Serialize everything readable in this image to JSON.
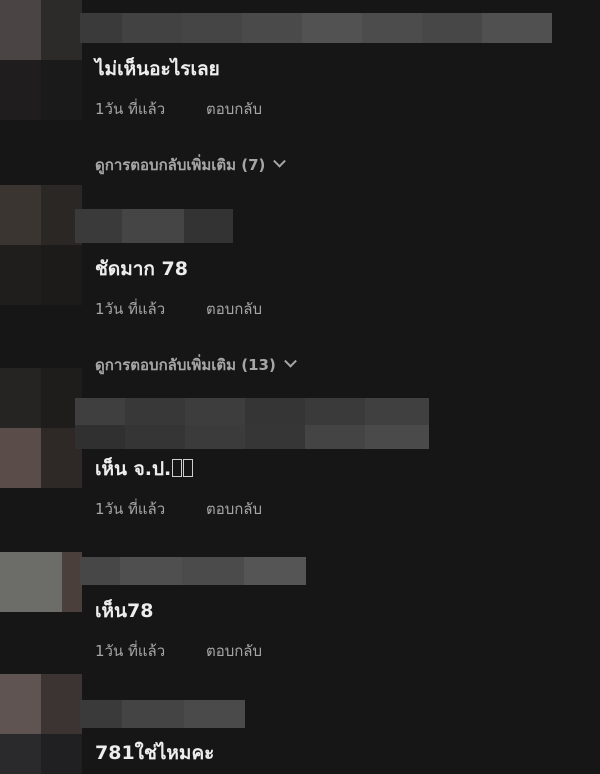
{
  "comments": [
    {
      "text": "ไม่เห็นอะไรเลย",
      "time": "1วัน ที่แล้ว",
      "reply": "ตอบกลับ",
      "more_replies": "ดูการตอบกลับเพิ่มเติม (7)"
    },
    {
      "text": "ชัดมาก 78",
      "time": "1วัน ที่แล้ว",
      "reply": "ตอบกลับ",
      "more_replies": "ดูการตอบกลับเพิ่มเติม (13)"
    },
    {
      "text": "เห็น จ.ป.",
      "time": "1วัน ที่แล้ว",
      "reply": "ตอบกลับ"
    },
    {
      "text": "เห็น78",
      "time": "1วัน ที่แล้ว",
      "reply": "ตอบกลับ"
    },
    {
      "text": "781ใช่ไหมคะ"
    }
  ],
  "icons": {
    "expand": "chevron-down-icon"
  },
  "colors": {
    "background": "#161616",
    "text": "#ededed",
    "muted": "#a6a6a6"
  }
}
